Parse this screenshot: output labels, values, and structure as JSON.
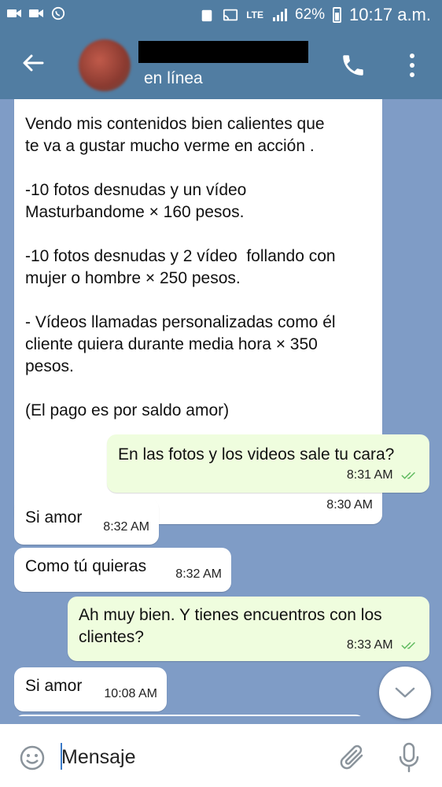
{
  "status_bar": {
    "network": "LTE",
    "battery": "62%",
    "time": "10:17 a.m."
  },
  "header": {
    "status": "en línea"
  },
  "messages": [
    {
      "direction": "incoming",
      "text": "Vendo mis contenidos bien calientes que\nte va a gustar mucho verme en acción .\n\n-10 fotos desnudas y un vídeo\nMasturbandome × 160 pesos.\n\n-10 fotos desnudas y 2 vídeo  follando con\nmujer o hombre × 250 pesos.\n\n- Vídeos llamadas personalizadas como él\ncliente quiera durante media hora × 350\npesos.\n\n(El pago es por saldo amor)",
      "time": "8:30 AM"
    },
    {
      "direction": "outgoing",
      "text": "En las fotos y los videos sale tu cara?",
      "time": "8:31 AM"
    },
    {
      "direction": "incoming",
      "text": "Si amor",
      "time": "8:32 AM"
    },
    {
      "direction": "incoming",
      "text": "Como tú quieras",
      "time": "8:32 AM"
    },
    {
      "direction": "outgoing",
      "text": "Ah muy bien. Y tienes encuentros con los\nclientes?",
      "time": "8:33 AM"
    },
    {
      "direction": "incoming",
      "text": "Si amor",
      "time": "10:08 AM"
    }
  ],
  "input": {
    "placeholder": "Mensaje"
  },
  "colors": {
    "header": "#517da2",
    "chat_background": "#7f9cc6",
    "outgoing_bubble": "#effdde",
    "incoming_bubble": "#ffffff",
    "read_ticks": "#5fba5f"
  },
  "icons": [
    "back-arrow-icon",
    "phone-icon",
    "more-vertical-icon",
    "emoji-icon",
    "attach-icon",
    "microphone-icon",
    "chevron-down-icon"
  ]
}
